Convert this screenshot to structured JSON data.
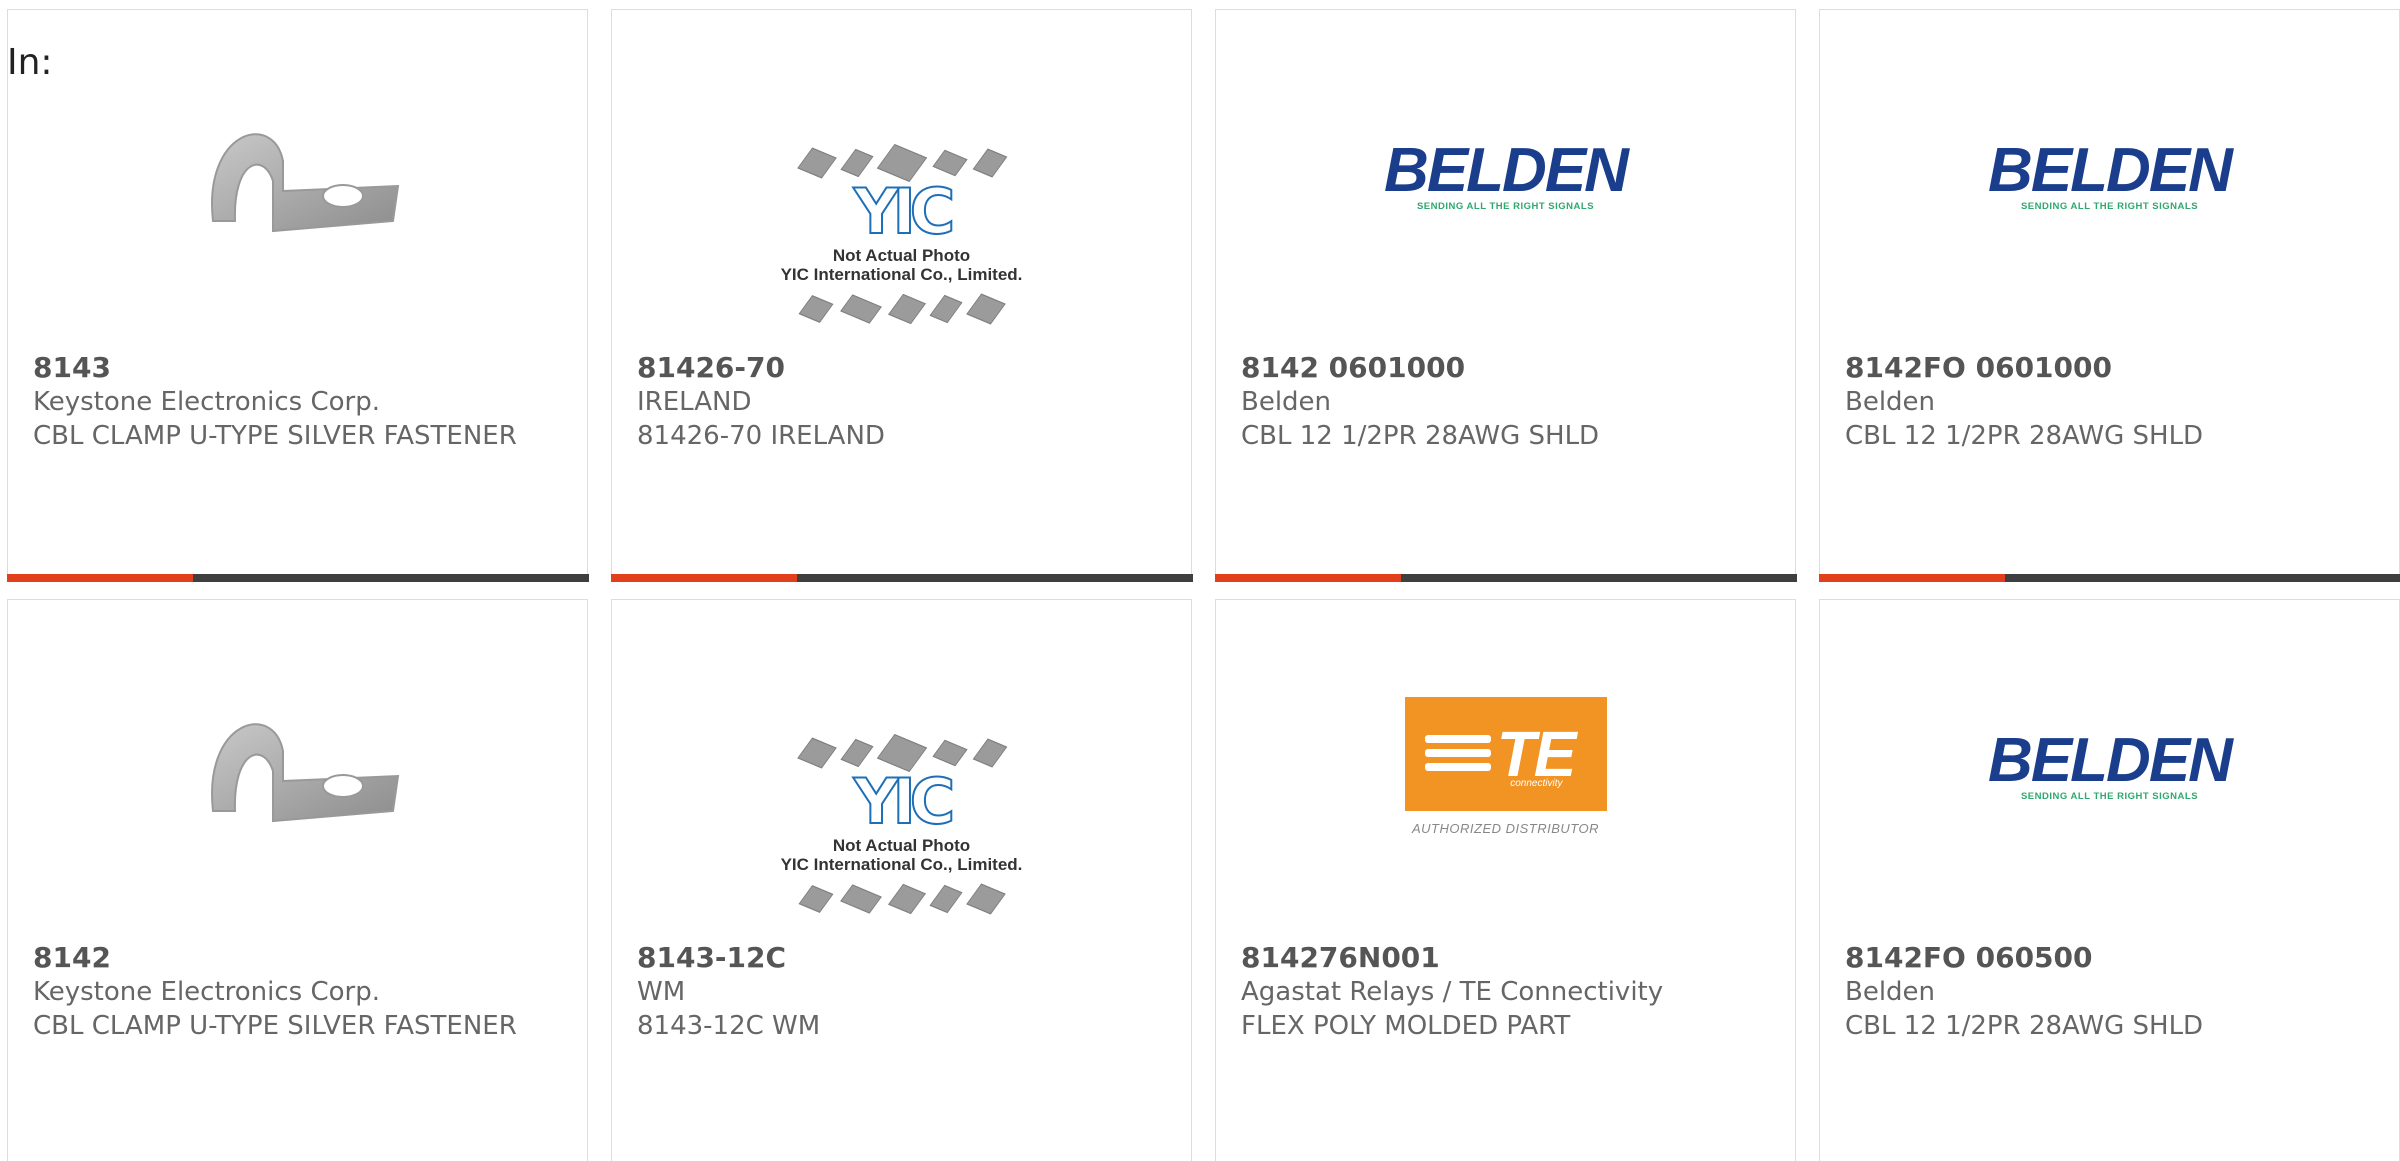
{
  "filter_label": "In:",
  "products": [
    {
      "part_number": "8143",
      "manufacturer": "Keystone Electronics Corp.",
      "description": "CBL CLAMP U-TYPE SILVER FASTENER",
      "image": "clamp",
      "progress": 0.32
    },
    {
      "part_number": "81426-70",
      "manufacturer": "IRELAND",
      "description": "81426-70 IRELAND",
      "image": "yic-placeholder",
      "progress": 0.32
    },
    {
      "part_number": "8142 0601000",
      "manufacturer": "Belden",
      "description": "CBL 12 1/2PR 28AWG SHLD",
      "image": "belden-logo",
      "progress": 0.32
    },
    {
      "part_number": "8142FO 0601000",
      "manufacturer": "Belden",
      "description": "CBL 12 1/2PR 28AWG SHLD",
      "image": "belden-logo",
      "progress": 0.32
    },
    {
      "part_number": "8142",
      "manufacturer": "Keystone Electronics Corp.",
      "description": "CBL CLAMP U-TYPE SILVER FASTENER",
      "image": "clamp"
    },
    {
      "part_number": "8143-12C",
      "manufacturer": "WM",
      "description": "8143-12C WM",
      "image": "yic-placeholder"
    },
    {
      "part_number": "814276N001",
      "manufacturer": "Agastat Relays / TE Connectivity",
      "description": "FLEX POLY MOLDED PART",
      "image": "te-logo"
    },
    {
      "part_number": "8142FO 060500",
      "manufacturer": "Belden",
      "description": "CBL 12 1/2PR 28AWG SHLD",
      "image": "belden-logo"
    }
  ],
  "yic": {
    "logo_text": "YIC",
    "caption_line1": "Not Actual Photo",
    "caption_line2": "YIC International Co., Limited."
  },
  "belden": {
    "wordmark": "BELDEN",
    "tagline": "SENDING ALL THE RIGHT SIGNALS"
  },
  "te": {
    "wordmark": "TE",
    "subword": "connectivity",
    "caption": "AUTHORIZED DISTRIBUTOR"
  },
  "colors": {
    "progress_fill": "#e2401c",
    "progress_track": "#3f3f3f",
    "belden_blue": "#1a3e8c",
    "belden_green": "#2ea86f",
    "te_orange": "#f29424",
    "yic_blue": "#1d6fb8"
  }
}
